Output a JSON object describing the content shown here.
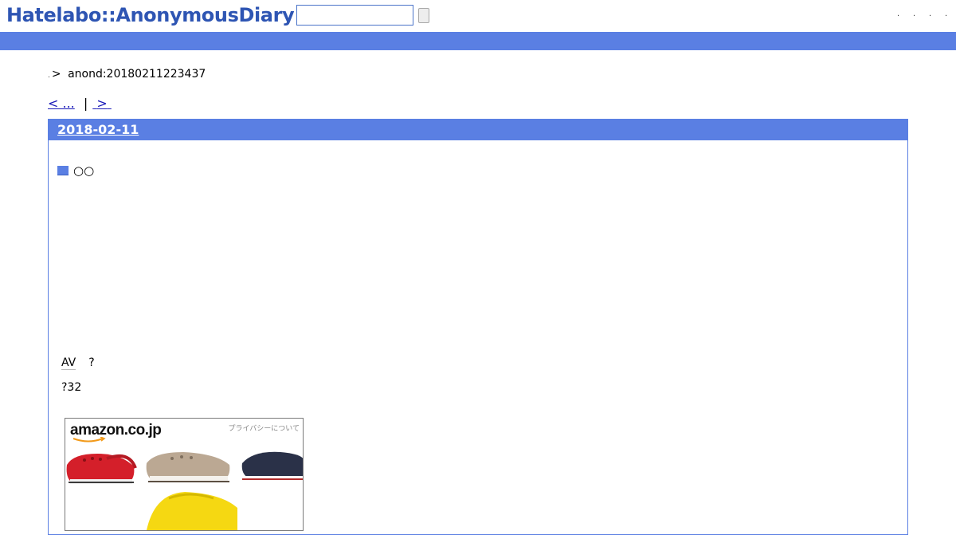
{
  "header": {
    "logo_text": "Hatelabo::AnonymousDiary",
    "search_value": "",
    "top_links": [
      ".",
      ".",
      ".",
      "."
    ]
  },
  "breadcrumb": {
    "home_label": ".",
    "separator": ">",
    "current": "anond:20180211223437"
  },
  "pager": {
    "prev_label": "< ...",
    "divider": "|",
    "next_label": ">"
  },
  "day": {
    "date": "2018-02-11",
    "section_title": "○○",
    "line1_keyword": "AV",
    "line1_rest": "?",
    "line2": "?32"
  },
  "ad": {
    "logo": "amazon.co.jp",
    "privacy": "プライバシーについて",
    "items": [
      "red-clog",
      "beige-clog",
      "navy-clog",
      "yellow-clog"
    ]
  },
  "colors": {
    "brand_blue": "#5a7fe3",
    "logo_blue": "#2e55b3",
    "link_blue": "#1a1ab8"
  }
}
